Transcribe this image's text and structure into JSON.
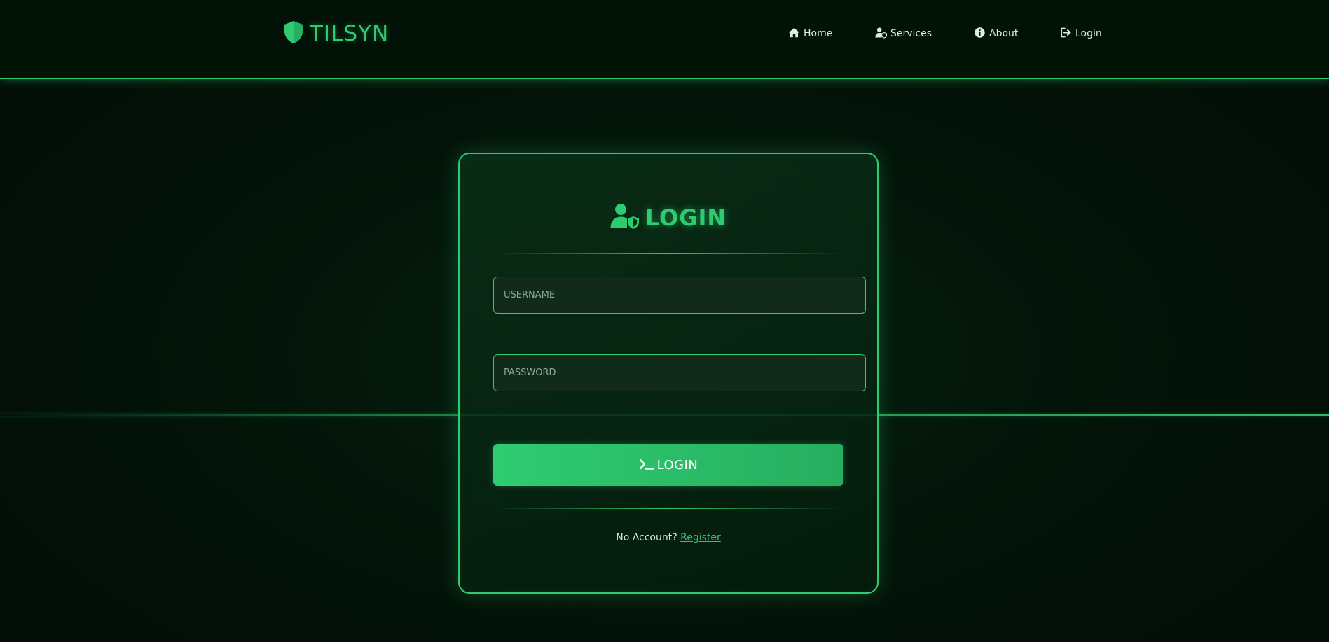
{
  "brand": {
    "name": "TILSYN",
    "icon": "shield-icon"
  },
  "nav": {
    "items": [
      {
        "label": "Home",
        "icon": "home-icon"
      },
      {
        "label": "Services",
        "icon": "user-shield-icon"
      },
      {
        "label": "About",
        "icon": "info-circle-icon"
      },
      {
        "label": "Login",
        "icon": "sign-in-icon"
      }
    ]
  },
  "login_card": {
    "title": "LOGIN",
    "title_icon": "user-shield-icon",
    "username_placeholder": "USERNAME",
    "username_value": "",
    "password_placeholder": "PASSWORD",
    "password_value": "",
    "submit_label": "LOGIN",
    "submit_icon": "terminal-icon",
    "register_prompt": "No Account?",
    "register_link": "Register"
  },
  "colors": {
    "accent": "#2ecc71",
    "accent_dark": "#27ae60",
    "background": "#021206",
    "card_background": "#0a3018",
    "text": "#cfe9d6"
  }
}
